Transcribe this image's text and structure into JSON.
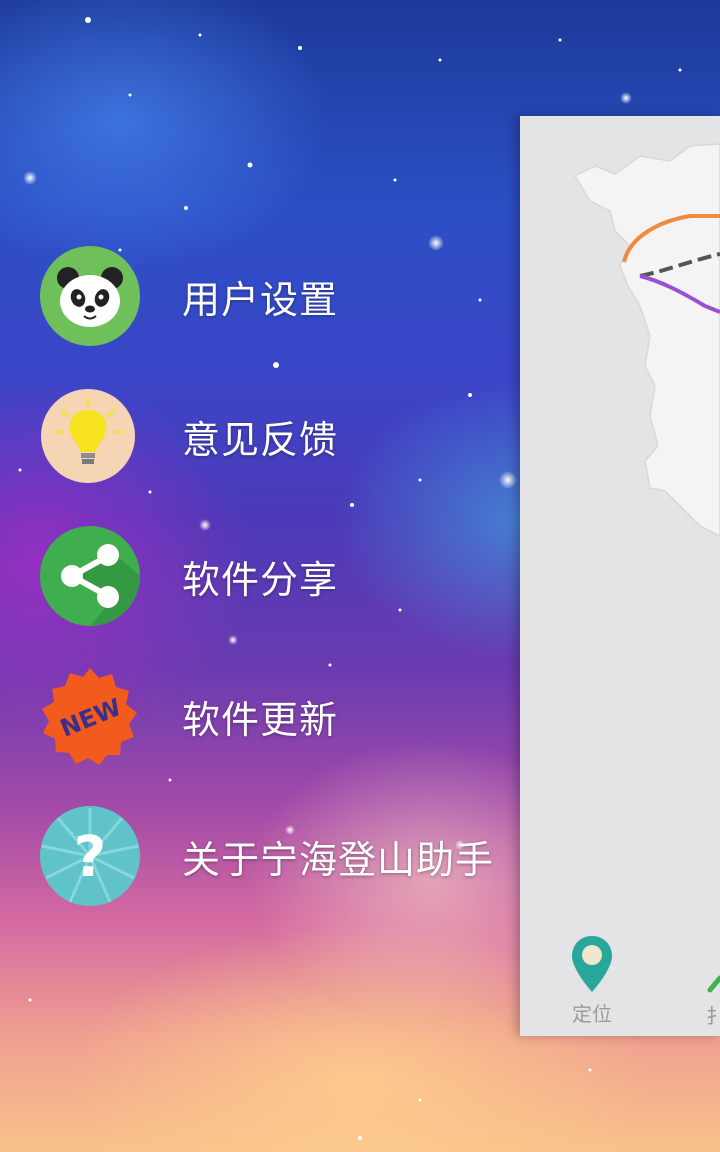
{
  "drawer": {
    "items": [
      {
        "label": "用户设置",
        "icon": "panda-icon"
      },
      {
        "label": "意见反馈",
        "icon": "lightbulb-icon"
      },
      {
        "label": "软件分享",
        "icon": "share-icon"
      },
      {
        "label": "软件更新",
        "icon": "new-badge-icon"
      },
      {
        "label": "关于宁海登山助手",
        "icon": "question-icon"
      }
    ],
    "new_badge_text": "NEW"
  },
  "bottom_nav": {
    "locate_label": "定位",
    "second_label_partial": "扌"
  },
  "colors": {
    "teal": "#2aa79b",
    "route_orange": "#f08a3c",
    "route_purple": "#9c4fd0",
    "panel_bg": "#e4e4e6"
  }
}
